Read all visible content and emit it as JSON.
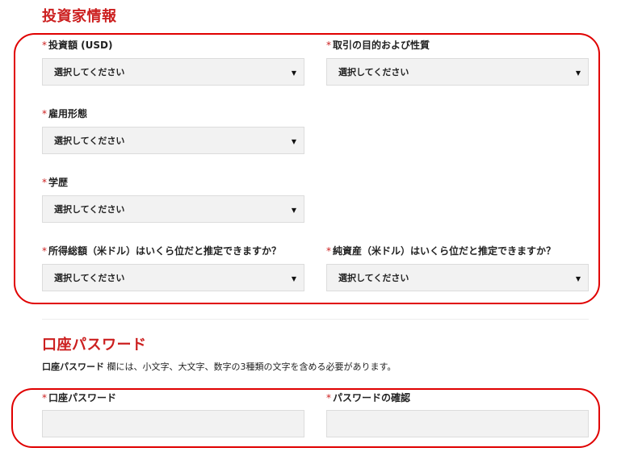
{
  "investor_section": {
    "title": "投資家情報",
    "fields": {
      "investment_amount": {
        "label": "投資額 (USD)",
        "value": "選択してください"
      },
      "trade_purpose": {
        "label": "取引の目的および性質",
        "value": "選択してください"
      },
      "employment": {
        "label": "雇用形態",
        "value": "選択してください"
      },
      "education": {
        "label": "学歴",
        "value": "選択してください"
      },
      "annual_income": {
        "label": "所得総額（米ドル）はいくら位だと推定できますか？",
        "value": "選択してください"
      },
      "net_worth": {
        "label": "純資産（米ドル）はいくら位だと推定できますか？",
        "value": "選択してください"
      }
    }
  },
  "password_section": {
    "title": "口座パスワード",
    "note_bold": "口座パスワード",
    "note_text": " 欄には、小文字、大文字、数字の3種類の文字を含める必要があります。",
    "fields": {
      "password": {
        "label": "口座パスワード",
        "value": ""
      },
      "confirm": {
        "label": "パスワードの確認",
        "value": ""
      }
    }
  },
  "required_marker": "*",
  "caret_icon": "▼",
  "colors": {
    "accent": "#cc1f1f",
    "highlight": "#e00000",
    "field_bg": "#f2f2f2"
  }
}
